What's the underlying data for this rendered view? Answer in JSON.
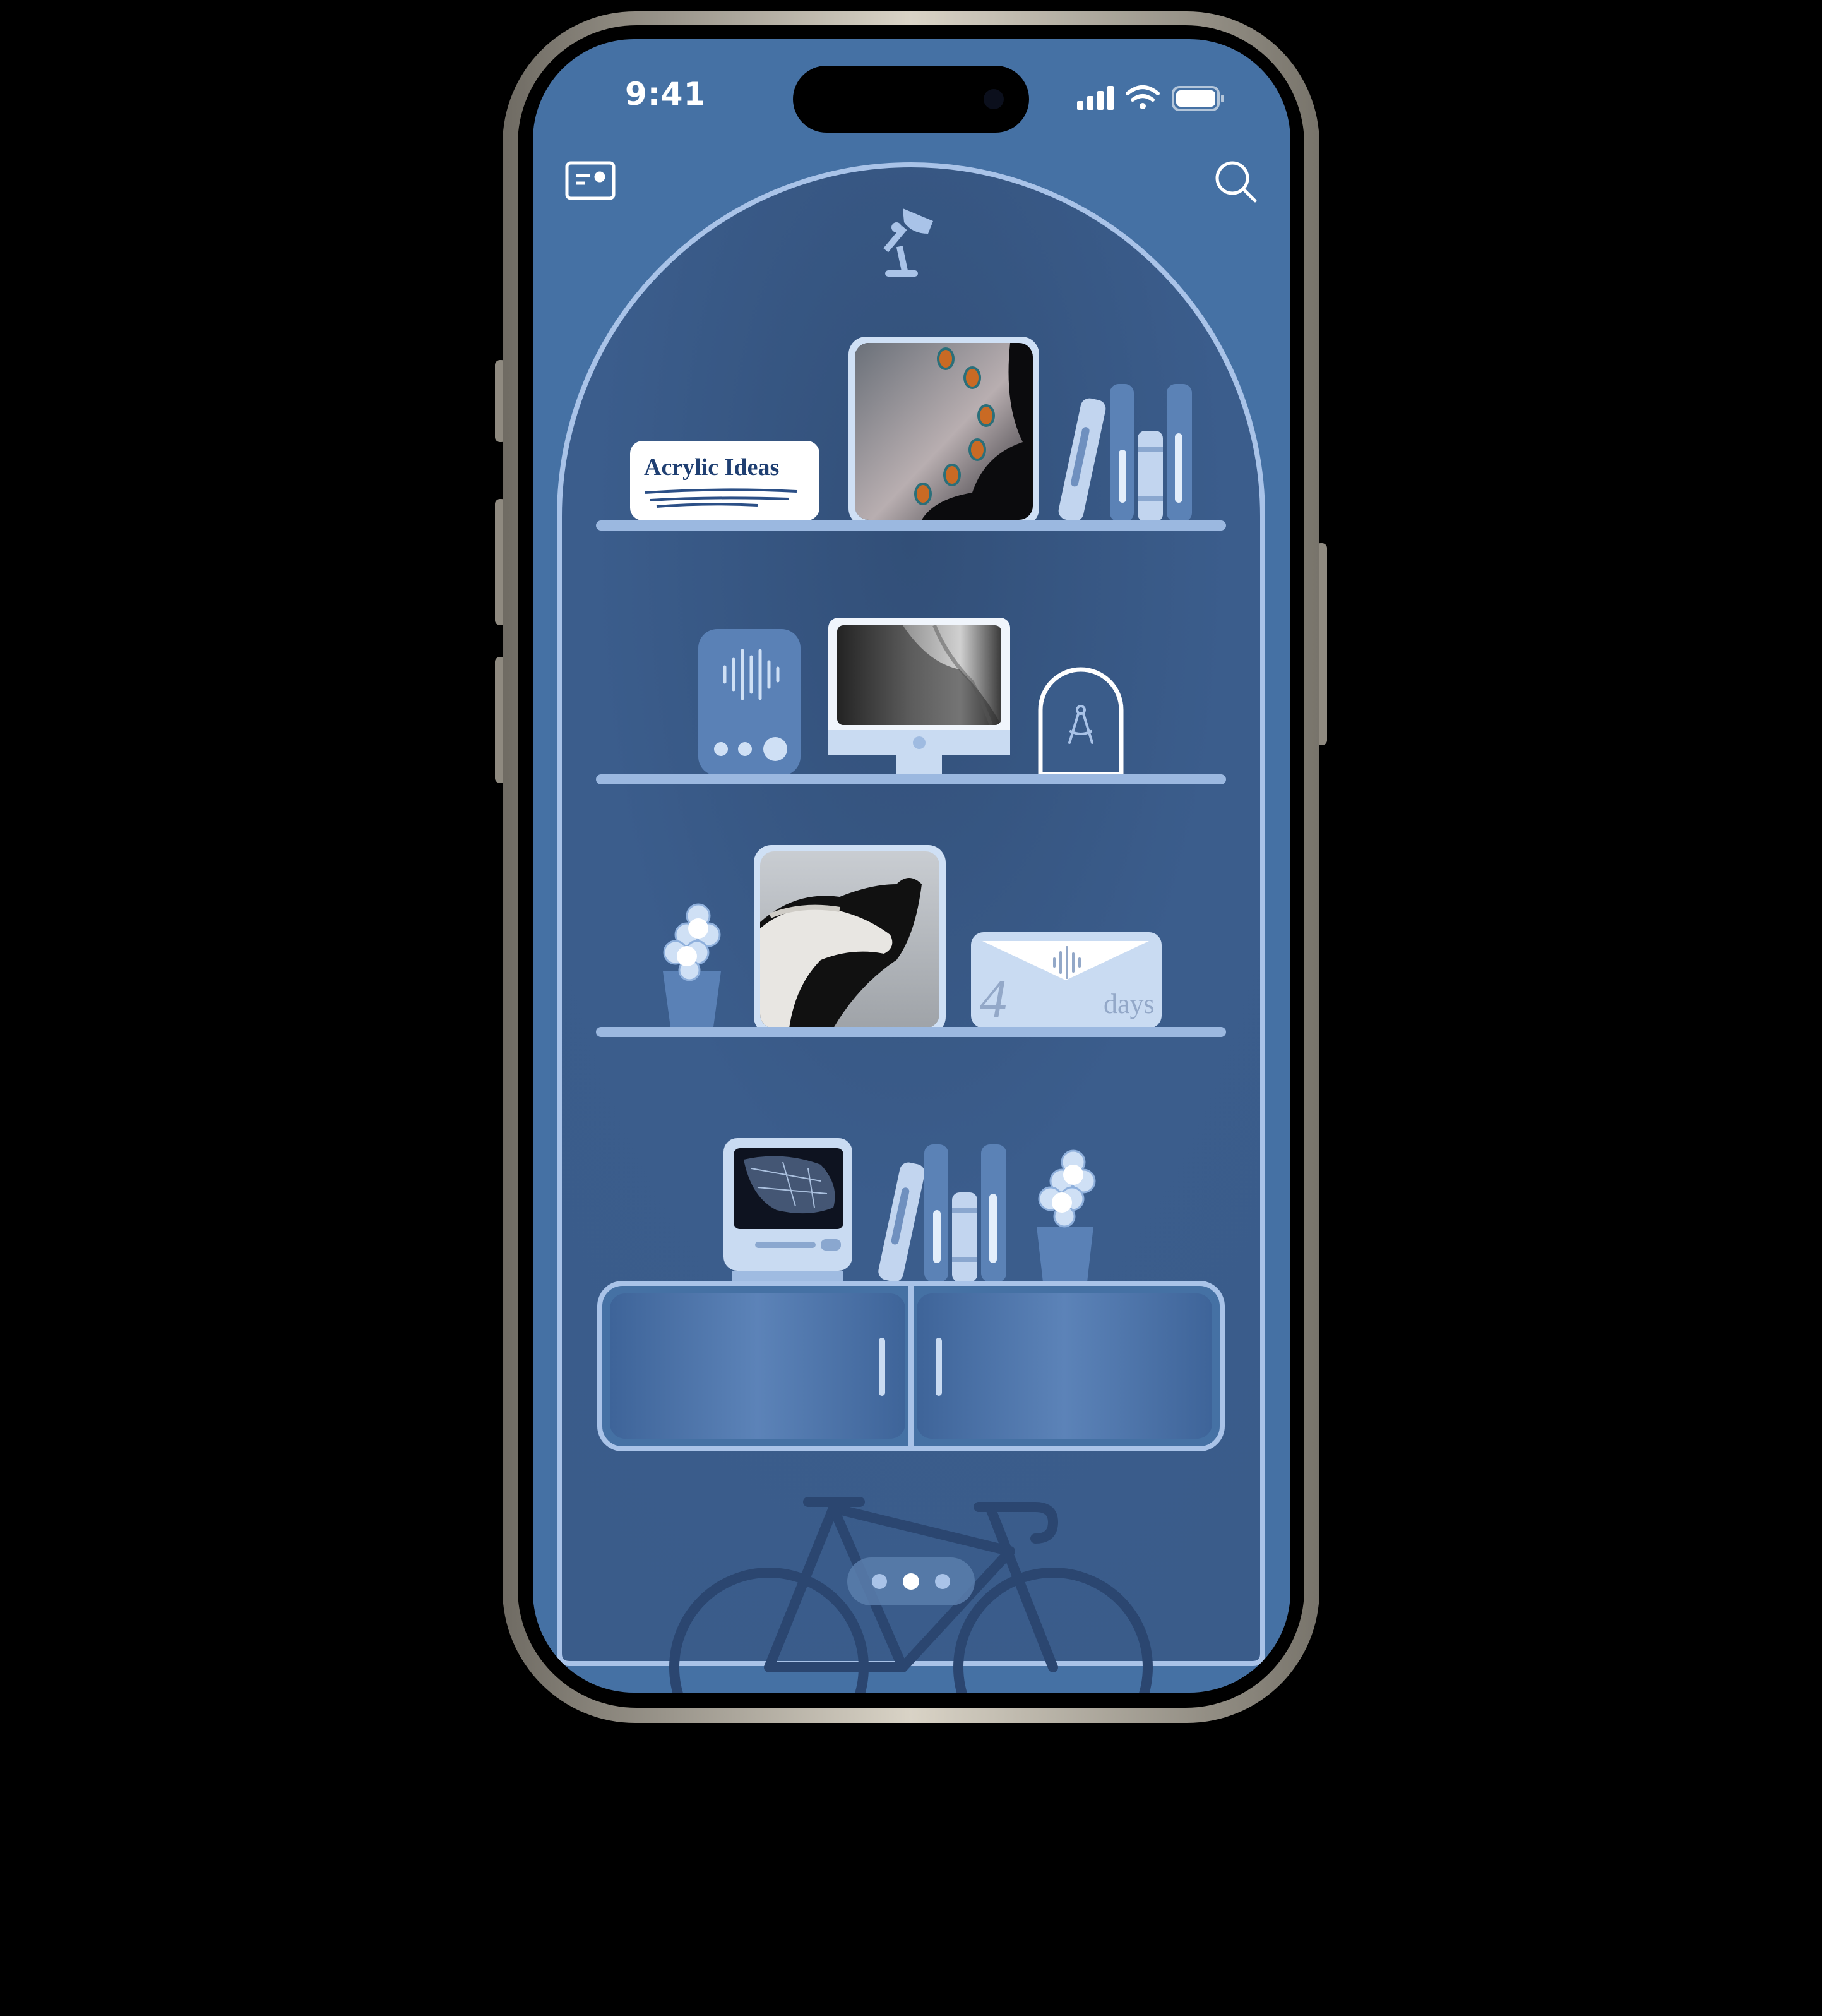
{
  "status_bar": {
    "time": "9:41",
    "icons": [
      "cellular-signal-icon",
      "wifi-icon",
      "battery-icon"
    ]
  },
  "toolbar": {
    "left_icon": "card-icon",
    "right_icon": "search-icon"
  },
  "shelves": [
    {
      "items": [
        {
          "kind": "note-card",
          "text": "Acrylic Ideas"
        },
        {
          "kind": "photo-frame",
          "subject": "butterfly wing photo"
        },
        {
          "kind": "books"
        }
      ]
    },
    {
      "items": [
        {
          "kind": "audio-speaker",
          "icon": "waveform-icon"
        },
        {
          "kind": "monitor",
          "subject": "back photo"
        },
        {
          "kind": "arch-frame",
          "icon": "compass-drawing-icon"
        }
      ]
    },
    {
      "items": [
        {
          "kind": "flower-vase"
        },
        {
          "kind": "photo-frame",
          "subject": "horses photo"
        },
        {
          "kind": "countdown-envelope",
          "number": "4",
          "unit": "days",
          "icon": "waveform-icon"
        }
      ]
    },
    {
      "items": [
        {
          "kind": "retro-computer",
          "subject": "insect wing photo"
        },
        {
          "kind": "books"
        },
        {
          "kind": "flower-vase"
        }
      ]
    }
  ],
  "page_indicator": {
    "count": 3,
    "active_index": 1
  },
  "decor": [
    "desk-lamp-icon",
    "bicycle-icon",
    "cabinet"
  ],
  "colors": {
    "background": "#000000",
    "screen": "#4571a4",
    "arch_inner": "#3a5c8a",
    "outline": "#a9c3e8",
    "note_text": "#1f3f72",
    "frame_metal": "#cfc9bc"
  }
}
